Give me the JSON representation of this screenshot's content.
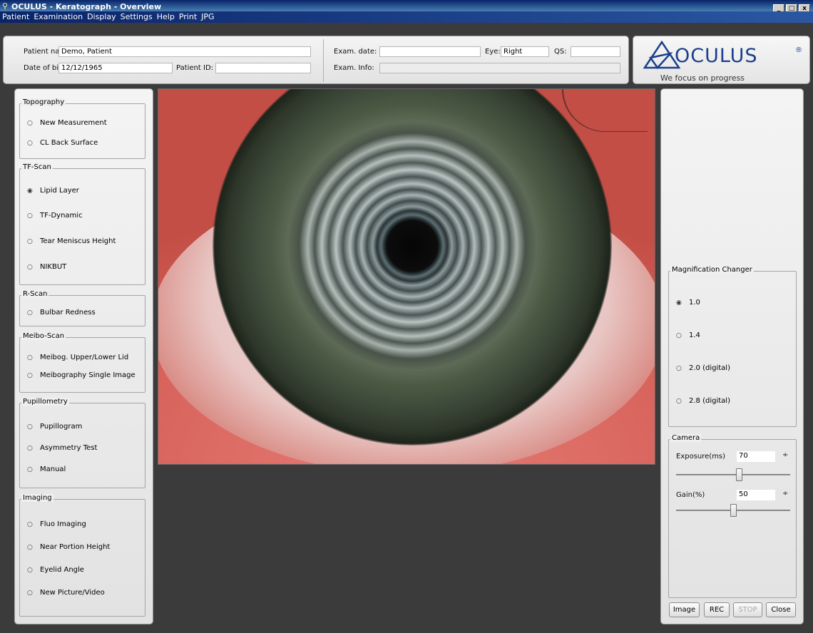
{
  "window": {
    "title": "OCULUS - Keratograph - Overview",
    "buttons": [
      "_",
      "□",
      "x"
    ]
  },
  "menu": [
    "Patient",
    "Examination",
    "Display",
    "Settings",
    "Help",
    "Print",
    "JPG"
  ],
  "patient": {
    "name_label": "Patient name:",
    "name_value": "Demo, Patient",
    "dob_label": "Date of birth:",
    "dob_value": "12/12/1965",
    "id_label": "Patient ID:",
    "id_value": ""
  },
  "exam": {
    "date_label": "Exam. date:",
    "date_value": "",
    "eye_label": "Eye:",
    "eye_value": "Right",
    "qs_label": "QS:",
    "qs_value": "",
    "info_label": "Exam. Info:",
    "info_value": ""
  },
  "logo": {
    "brand": "OCULUS",
    "mark": "®",
    "tagline": "We focus on progress"
  },
  "left_panel": {
    "topography": {
      "title": "Topography",
      "items": [
        "New Measurement",
        "CL Back Surface"
      ]
    },
    "tfscan": {
      "title": "TF-Scan",
      "items": [
        "Lipid Layer",
        "TF-Dynamic",
        "Tear Meniscus Height",
        "NIKBUT"
      ],
      "selected": "Lipid Layer"
    },
    "rscan": {
      "title": "R-Scan",
      "items": [
        "Bulbar Redness"
      ]
    },
    "meibo": {
      "title": "Meibo-Scan",
      "items": [
        "Meibog. Upper/Lower Lid",
        "Meibography Single Image"
      ]
    },
    "pupil": {
      "title": "Pupillometry",
      "items": [
        "Pupillogram",
        "Asymmetry Test",
        "Manual"
      ]
    },
    "imaging": {
      "title": "Imaging",
      "items": [
        "Fluo Imaging",
        "Near Portion Height",
        "Eyelid Angle",
        "New Picture/Video"
      ]
    }
  },
  "magnification": {
    "title": "Magnification Changer",
    "options": [
      "1.0",
      "1.4",
      "2.0 (digital)",
      "2.8 (digital)"
    ],
    "selected": "1.0"
  },
  "camera": {
    "title": "Camera",
    "exposure_label": "Exposure(ms)",
    "exposure_value": "70",
    "exposure_level": 0.55,
    "gain_label": "Gain(%)",
    "gain_value": "50",
    "gain_level": 0.5
  },
  "buttons": {
    "image": "Image",
    "rec": "REC",
    "stop": "STOP",
    "close": "Close"
  },
  "icons": {
    "spin": "spinbox-arrows-icon",
    "radio_on": "radio-selected-icon",
    "radio_off": "radio-unselected-icon"
  }
}
